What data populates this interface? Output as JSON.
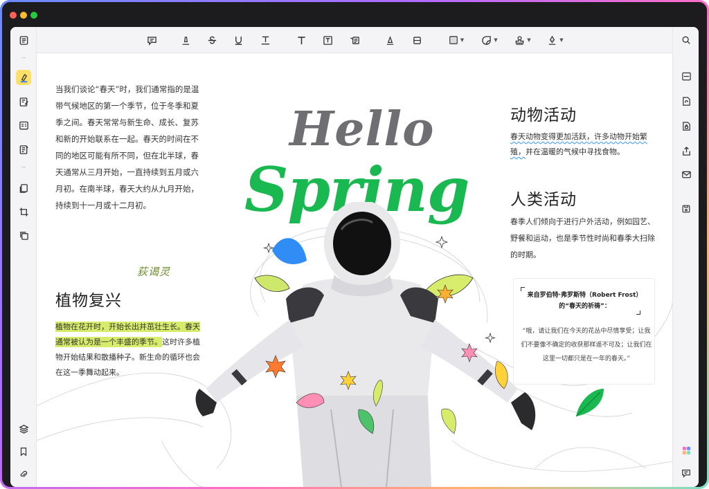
{
  "left_column": {
    "paragraph": "当我们谈论“春天”时，我们通常指的是温带气候地区的第一个季节，位于冬季和夏季之间。春天常常与新生命、成长、复苏和新的开始联系在一起。春天的时间在不同的地区可能有所不同，但在北半球，春天通常从三月开始，一直持续到五月或六月初。在南半球，春天大约从九月开始，持续到十一月或十二月初。",
    "signature": "荻谒灵",
    "heading": "植物复兴",
    "highlight_text": "植物在花开时，开始长出并茁壮生长。春天通常被认为是一个丰盛的季节。",
    "rest_text": "这时许多植物开始结果和散播种子。新生命的循环也会在这一季舞动起来。"
  },
  "center": {
    "title_line1": "Hello",
    "title_line2": "Spring"
  },
  "right_column": {
    "heading1": "动物活动",
    "para1_underlined": "春天动物变得更加活跃，许多动物开始繁殖，",
    "para1_rest": "并在温暖的气候中寻找食物。",
    "heading2": "人类活动",
    "para2": "春季人们倾向于进行户外活动，例如园艺、野餐和运动，也是季节性时尚和春季大扫除的时期。"
  },
  "quote": {
    "title": "来自罗伯特·弗罗斯特（Robert Frost）的“春天的祈祷”：",
    "body": "“哦，请让我们在今天的花丛中尽情享受；让我们不要像不确定的收获那样遥不可及；让我们在这里一切都只是在一年的春天。”"
  },
  "colors": {
    "accent_green": "#1ab850",
    "hello_gray": "#6f6f73",
    "highlight": "#d7ec6a",
    "active_tool": "#ffe066"
  }
}
